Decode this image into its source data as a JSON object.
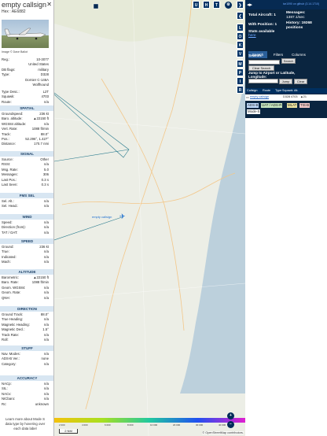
{
  "left_panel": {
    "callsign": "empty callsign",
    "hex": "Hex : AE6882",
    "image_credit": "Image © Dave Ballot",
    "reg_label": "Reg.:",
    "reg_value": "10-3077",
    "country": "United States",
    "db_flags_label": "DB flags:",
    "db_flags_value": "military",
    "type_label": "Type:",
    "type_value": "D328",
    "type_desc_1": "Dornier C-146A",
    "type_desc_2": "Wolfhound",
    "type_desc_label": "Type Desc.:",
    "type_desc_value": "L2T",
    "squawk_label": "Squawk:",
    "squawk_value": "4703",
    "route_label": "Route:",
    "route_value": "n/a",
    "sections": {
      "spatial": "SPATIAL",
      "signal": "SIGNAL",
      "fms": "FMS SEL",
      "wind": "WIND",
      "speed": "SPEED",
      "altitude": "ALTITUDE",
      "direction": "DIRECTION",
      "stuff": "STUFF",
      "accuracy": "ACCURACY"
    },
    "spatial": [
      {
        "k": "Groundspeed:",
        "v": "236 kt"
      },
      {
        "k": "Baro. altitude:",
        "v": "▲22150 ft"
      },
      {
        "k": "WGS84 altitude:",
        "v": "n/a"
      },
      {
        "k": "Vert. Rate:",
        "v": "1088 ft/min"
      },
      {
        "k": "Track:",
        "v": "88.0°"
      },
      {
        "k": "Pos.:",
        "v": "52.296°, 1.427°"
      },
      {
        "k": "Distance:",
        "v": "170.7 nmi"
      }
    ],
    "signal": [
      {
        "k": "Source:",
        "v": "Other"
      },
      {
        "k": "RSSI:",
        "v": "n/a"
      },
      {
        "k": "Msg. Rate:",
        "v": "5.0"
      },
      {
        "k": "Messages:",
        "v": "306"
      },
      {
        "k": "Last Pos.:",
        "v": "0.3 s"
      },
      {
        "k": "Last Seen:",
        "v": "0.3 s"
      }
    ],
    "fms": [
      {
        "k": "Sel. Alt.:",
        "v": "n/a"
      },
      {
        "k": "Sel. Head.:",
        "v": "n/a"
      }
    ],
    "wind": [
      {
        "k": "Speed:",
        "v": "n/a"
      },
      {
        "k": "Direction (from):",
        "v": "n/a"
      },
      {
        "k": "TAT / OAT:",
        "v": "n/a"
      }
    ],
    "speed": [
      {
        "k": "Ground:",
        "v": "236 kt"
      },
      {
        "k": "True:",
        "v": "n/a"
      },
      {
        "k": "Indicated:",
        "v": "n/a"
      },
      {
        "k": "Mach:",
        "v": "n/a"
      }
    ],
    "altitude": [
      {
        "k": "Barometric:",
        "v": "▲22150 ft"
      },
      {
        "k": "Baro. Rate:",
        "v": "1088 ft/min"
      },
      {
        "k": "Geom. WGS84:",
        "v": "n/a"
      },
      {
        "k": "Geom. Rate:",
        "v": "n/a"
      },
      {
        "k": "QNH:",
        "v": "n/a"
      }
    ],
    "direction": [
      {
        "k": "Ground Track:",
        "v": "88.0°"
      },
      {
        "k": "True Heading:",
        "v": "n/a"
      },
      {
        "k": "Magnetic Heading:",
        "v": "n/a"
      },
      {
        "k": "Magnetic Decl.:",
        "v": "1.5°"
      },
      {
        "k": "Track Rate:",
        "v": "n/a"
      },
      {
        "k": "Roll:",
        "v": "n/a"
      }
    ],
    "stuff": [
      {
        "k": "Nav. Modes:",
        "v": "n/a"
      },
      {
        "k": "ADS-B Ver.:",
        "v": "none"
      },
      {
        "k": "Category:",
        "v": "n/a"
      }
    ],
    "accuracy": [
      {
        "k": "NACp:",
        "v": "n/a"
      },
      {
        "k": "SIL:",
        "v": "n/a"
      },
      {
        "k": "NACv:",
        "v": "n/a"
      },
      {
        "k": "NICbaro:",
        "v": "n/a"
      },
      {
        "k": "Rc:",
        "v": "unknown"
      }
    ],
    "footer_1": "Learn more about Mode S",
    "footer_2": "data type by hovering over",
    "footer_3": "each data label"
  },
  "map": {
    "zoom_in": "+",
    "zoom_out": "−",
    "scale": "2 NM",
    "attribution": "© OpenStreetMap contributors.",
    "aircraft_label": "empty callsign",
    "altitude_scale": [
      "2 000",
      "4 000",
      "6 000",
      "8 000",
      "10 000",
      "20 000",
      "30 000",
      "40 000"
    ],
    "top_buttons": [
      "U",
      "H",
      "T"
    ],
    "side_buttons": [
      "L",
      "O",
      "K",
      "V",
      "M",
      "P",
      "I",
      "R"
    ]
  },
  "panel": {
    "version_link": "tar1090 on github (3.14.1710)",
    "total_label": "Total Aircraft: 1",
    "messages_label": "Messages:",
    "messages_value": "1387.1/sec",
    "with_position": "With Position: 1",
    "history_label": "History: 19268 positions",
    "stats_1": "Stats available",
    "stats_2": "here",
    "tabs": [
      "Search",
      "Filters",
      "Columns"
    ],
    "search_label": "Search:",
    "search_btn": "Search",
    "clear_search_btn": "Clear Search",
    "jump_label_1": "Jump to Airport or Latitude,",
    "jump_label_2": "Longitude:",
    "jump_btn": "Jump",
    "clear_btn": "Clear",
    "table_headers": [
      "Callsign",
      "Route",
      "Type",
      "Squawk",
      "Alt."
    ],
    "table_row": [
      "empty callsign",
      "",
      "D328",
      "4703",
      "▲21"
    ],
    "badges": [
      "ADS-B",
      "UAT / ADS-R",
      "MLAT",
      "TIS-B",
      "Mode-S"
    ],
    "colors": {
      "adsb": "#bfd8f8",
      "uat": "#c8e8c0",
      "mlat": "#f0e6a0",
      "tisb": "#f2c8c8",
      "modes": "#ffffff"
    }
  }
}
